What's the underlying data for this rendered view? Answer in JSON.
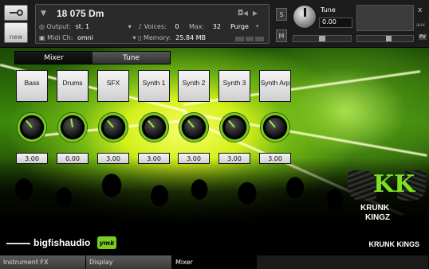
{
  "header": {
    "instrument_name": "18 075 Dm",
    "output_label": "Output:",
    "output_value": "st. 1",
    "midi_label": "Midi Ch:",
    "midi_value": "omni",
    "voices_label": "Voices:",
    "voices_value": "0",
    "max_label": "Max:",
    "max_value": "32",
    "memory_label": "Memory:",
    "memory_value": "25.84 MB",
    "purge_label": "Purge",
    "new_label": "new",
    "solo_label": "S",
    "mute_label": "M",
    "tune_label": "Tune",
    "tune_value": "0.00",
    "close_label": "x",
    "aux_label": "aux",
    "pv_label": "PV"
  },
  "view_tabs": [
    {
      "label": "Mixer",
      "active": true
    },
    {
      "label": "Tune",
      "active": false
    }
  ],
  "channels": [
    {
      "label": "Bass",
      "value": "3.00"
    },
    {
      "label": "Drums",
      "value": "0.00"
    },
    {
      "label": "SFX",
      "value": "3.00"
    },
    {
      "label": "Synth 1",
      "value": "3.00"
    },
    {
      "label": "Synth 2",
      "value": "3.00"
    },
    {
      "label": "Synth 3",
      "value": "3.00"
    },
    {
      "label": "Synth Arp",
      "value": "3.00"
    }
  ],
  "logo": {
    "mark": "KK",
    "line1": "KRUNK",
    "line2": "KINGZ"
  },
  "footer": {
    "publisher": "bigfishaudio",
    "badge": "ymk",
    "product": "KRUNK KINGS"
  },
  "bottom_tabs": [
    {
      "label": "Instrument FX"
    },
    {
      "label": "Display"
    },
    {
      "label": "Mixer"
    }
  ],
  "colors": {
    "accent_green": "#7acb22",
    "header_bg": "#1c1c1c"
  }
}
